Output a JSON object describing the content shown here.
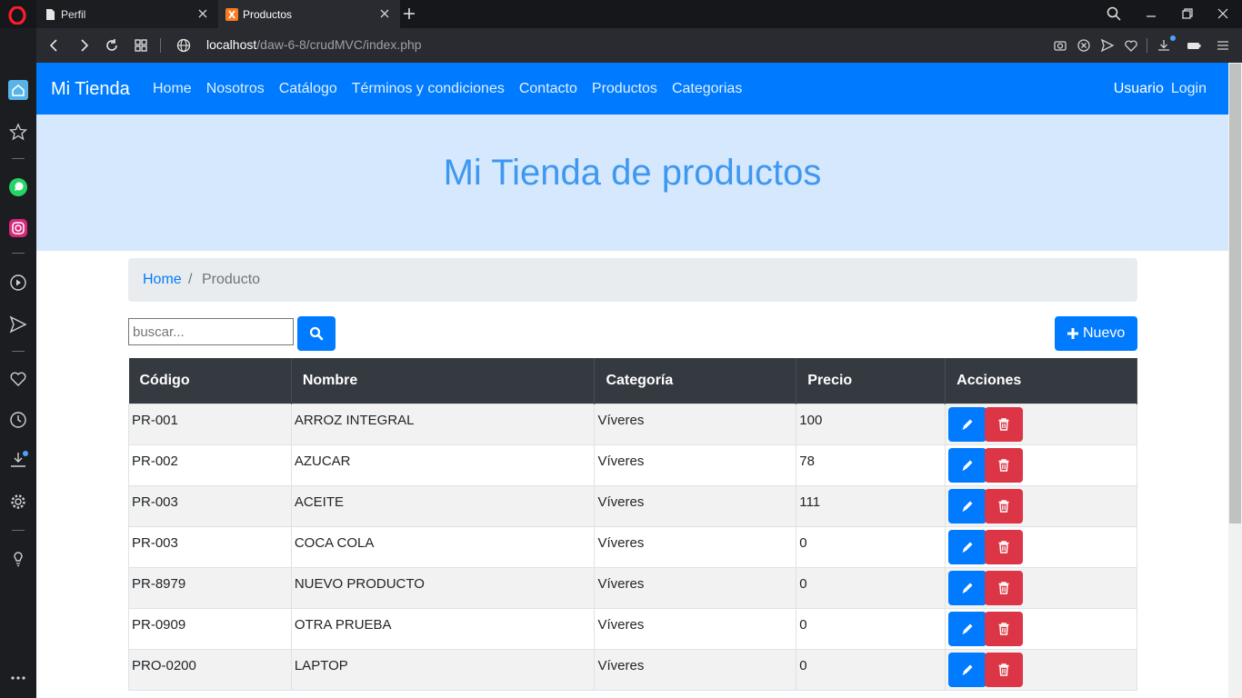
{
  "browser": {
    "tabs": [
      {
        "label": "Perfil",
        "active": false
      },
      {
        "label": "Productos",
        "active": true
      }
    ],
    "url_host": "localhost",
    "url_path": "/daw-6-8/crudMVC/index.php"
  },
  "navbar": {
    "brand": "Mi Tienda",
    "links": [
      "Home",
      "Nosotros",
      "Catálogo",
      "Términos y condiciones",
      "Contacto",
      "Productos",
      "Categorias"
    ],
    "user": "Usuario",
    "login": "Login"
  },
  "jumbotron": {
    "title": "Mi Tienda de productos"
  },
  "breadcrumb": {
    "home": "Home",
    "separator": "/",
    "current": "Producto"
  },
  "search": {
    "placeholder": "buscar..."
  },
  "toolbar": {
    "new_label": "Nuevo"
  },
  "table": {
    "headers": [
      "Código",
      "Nombre",
      "Categoría",
      "Precio",
      "Acciones"
    ],
    "rows": [
      {
        "codigo": "PR-001",
        "nombre": "ARROZ INTEGRAL",
        "categoria": "Víveres",
        "precio": "100"
      },
      {
        "codigo": "PR-002",
        "nombre": "AZUCAR",
        "categoria": "Víveres",
        "precio": "78"
      },
      {
        "codigo": "PR-003",
        "nombre": "ACEITE",
        "categoria": "Víveres",
        "precio": "111"
      },
      {
        "codigo": "PR-003",
        "nombre": "COCA COLA",
        "categoria": "Víveres",
        "precio": "0"
      },
      {
        "codigo": "PR-8979",
        "nombre": "NUEVO PRODUCTO",
        "categoria": "Víveres",
        "precio": "0"
      },
      {
        "codigo": "PR-0909",
        "nombre": "OTRA PRUEBA",
        "categoria": "Víveres",
        "precio": "0"
      },
      {
        "codigo": "PRO-0200",
        "nombre": "LAPTOP",
        "categoria": "Víveres",
        "precio": "0"
      }
    ]
  },
  "colors": {
    "primary": "#007bff",
    "danger": "#dc3545",
    "jumbotron_bg": "#d5e8fe",
    "jumbotron_text": "#3f98f0",
    "table_header_bg": "#343a40"
  }
}
